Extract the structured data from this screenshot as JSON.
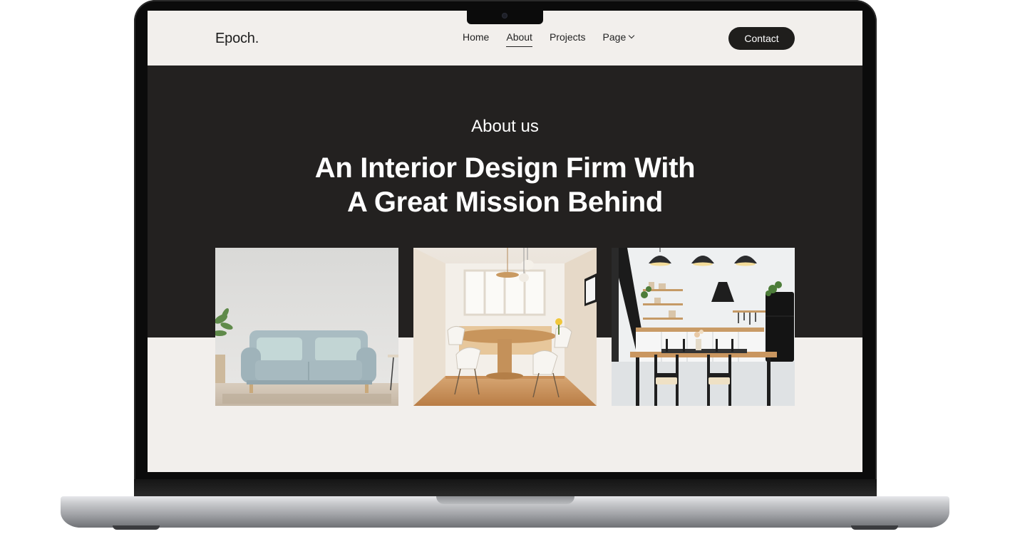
{
  "header": {
    "logo": "Epoch.",
    "nav": [
      {
        "label": "Home"
      },
      {
        "label": "About"
      },
      {
        "label": "Projects"
      },
      {
        "label": "Page"
      }
    ],
    "contact_label": "Contact"
  },
  "hero": {
    "eyebrow": "About us",
    "title_line1": "An Interior Design Firm With",
    "title_line2": "A Great Mission Behind"
  },
  "gallery": [
    {
      "subject": "living room with light blue sofa"
    },
    {
      "subject": "dining room with round wooden table"
    },
    {
      "subject": "kitchen with black pendant lamps and dining table"
    }
  ],
  "colors": {
    "page_bg": "#f2efec",
    "hero_bg": "#232120",
    "button_bg": "#1f1e1c",
    "text_dark": "#1d1d1d"
  }
}
